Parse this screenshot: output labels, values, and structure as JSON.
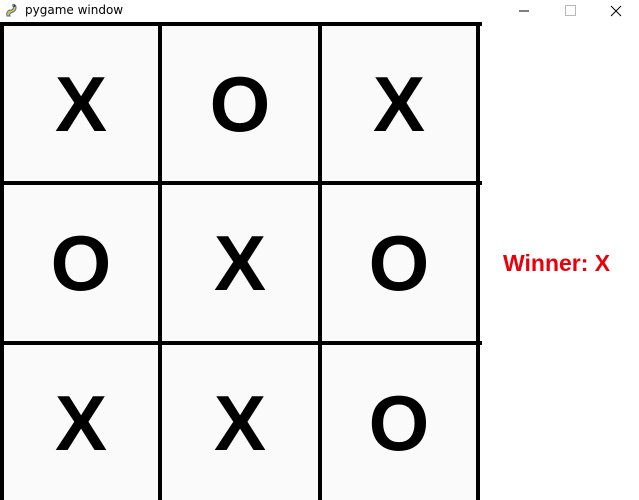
{
  "window": {
    "title": "pygame window",
    "icon": "pygame-snake-icon",
    "controls": [
      "minimize-icon",
      "maximize-icon",
      "close-icon"
    ]
  },
  "board": {
    "cells": [
      "X",
      "O",
      "X",
      "O",
      "X",
      "O",
      "X",
      "X",
      "O"
    ],
    "mark_color": "#000000",
    "grid_color": "#000000",
    "cell_background": "#fafafa"
  },
  "status": {
    "winner_text": "Winner: X",
    "color": "#e8000b"
  }
}
